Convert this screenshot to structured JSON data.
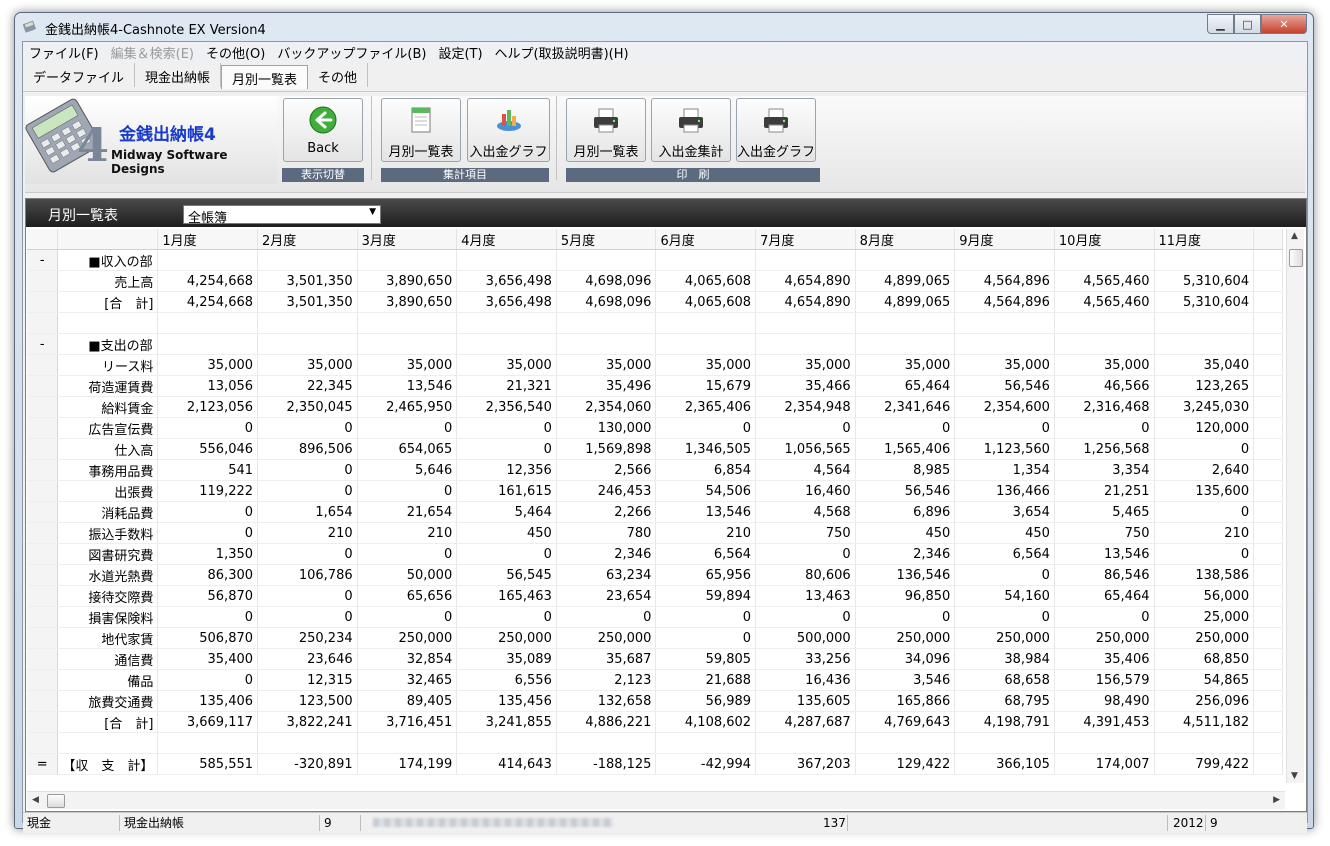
{
  "window": {
    "title": "金銭出納帳4-Cashnote EX Version4"
  },
  "menu": [
    {
      "label": "ファイル(F)",
      "disabled": false
    },
    {
      "label": "編集＆検索(E)",
      "disabled": true
    },
    {
      "label": "その他(O)",
      "disabled": false
    },
    {
      "label": "バックアップファイル(B)",
      "disabled": false
    },
    {
      "label": "設定(T)",
      "disabled": false
    },
    {
      "label": "ヘルプ(取扱説明書)(H)",
      "disabled": false
    }
  ],
  "tabs": [
    {
      "label": "データファイル",
      "active": false
    },
    {
      "label": "現金出納帳",
      "active": false
    },
    {
      "label": "月別一覧表",
      "active": true
    },
    {
      "label": "その他",
      "active": false
    }
  ],
  "logo": {
    "title": "金銭出納帳4",
    "subtitle": "Midway Software Designs",
    "digit": "4"
  },
  "toolbar": {
    "back_label": "Back",
    "group1_caption": "表示切替",
    "monthly_list_label": "月別一覧表",
    "inout_graph_label": "入出金グラフ",
    "group2_caption": "集計項目",
    "print_monthly_label": "月別一覧表",
    "print_summary_label": "入出金集計",
    "print_graph_label": "入出金グラフ",
    "group3_caption": "印　刷"
  },
  "panel": {
    "title": "月別一覧表",
    "ledger_selected": "全帳簿"
  },
  "table": {
    "columns": [
      "1月度",
      "2月度",
      "3月度",
      "4月度",
      "5月度",
      "6月度",
      "7月度",
      "8月度",
      "9月度",
      "10月度",
      "11月度"
    ],
    "rows": [
      {
        "mark": "-",
        "label": "■収入の部",
        "heading": true,
        "values": []
      },
      {
        "mark": "",
        "label": "売上高",
        "values": [
          "4,254,668",
          "3,501,350",
          "3,890,650",
          "3,656,498",
          "4,698,096",
          "4,065,608",
          "4,654,890",
          "4,899,065",
          "4,564,896",
          "4,565,460",
          "5,310,604"
        ]
      },
      {
        "mark": "",
        "label": "[合　計]",
        "values": [
          "4,254,668",
          "3,501,350",
          "3,890,650",
          "3,656,498",
          "4,698,096",
          "4,065,608",
          "4,654,890",
          "4,899,065",
          "4,564,896",
          "4,565,460",
          "5,310,604"
        ]
      },
      {
        "mark": "",
        "label": "",
        "values": []
      },
      {
        "mark": "-",
        "label": "■支出の部",
        "heading": true,
        "values": []
      },
      {
        "mark": "",
        "label": "リース料",
        "values": [
          "35,000",
          "35,000",
          "35,000",
          "35,000",
          "35,000",
          "35,000",
          "35,000",
          "35,000",
          "35,000",
          "35,000",
          "35,040"
        ]
      },
      {
        "mark": "",
        "label": "荷造運賃費",
        "values": [
          "13,056",
          "22,345",
          "13,546",
          "21,321",
          "35,496",
          "15,679",
          "35,466",
          "65,464",
          "56,546",
          "46,566",
          "123,265"
        ]
      },
      {
        "mark": "",
        "label": "給料賃金",
        "values": [
          "2,123,056",
          "2,350,045",
          "2,465,950",
          "2,356,540",
          "2,354,060",
          "2,365,406",
          "2,354,948",
          "2,341,646",
          "2,354,600",
          "2,316,468",
          "3,245,030"
        ]
      },
      {
        "mark": "",
        "label": "広告宣伝費",
        "values": [
          "0",
          "0",
          "0",
          "0",
          "130,000",
          "0",
          "0",
          "0",
          "0",
          "0",
          "120,000"
        ]
      },
      {
        "mark": "",
        "label": "仕入高",
        "values": [
          "556,046",
          "896,506",
          "654,065",
          "0",
          "1,569,898",
          "1,346,505",
          "1,056,565",
          "1,565,406",
          "1,123,560",
          "1,256,568",
          "0"
        ]
      },
      {
        "mark": "",
        "label": "事務用品費",
        "values": [
          "541",
          "0",
          "5,646",
          "12,356",
          "2,566",
          "6,854",
          "4,564",
          "8,985",
          "1,354",
          "3,354",
          "2,640"
        ]
      },
      {
        "mark": "",
        "label": "出張費",
        "values": [
          "119,222",
          "0",
          "0",
          "161,615",
          "246,453",
          "54,506",
          "16,460",
          "56,546",
          "136,466",
          "21,251",
          "135,600"
        ]
      },
      {
        "mark": "",
        "label": "消耗品費",
        "values": [
          "0",
          "1,654",
          "21,654",
          "5,464",
          "2,266",
          "13,546",
          "4,568",
          "6,896",
          "3,654",
          "5,465",
          "0"
        ]
      },
      {
        "mark": "",
        "label": "振込手数料",
        "values": [
          "0",
          "210",
          "210",
          "450",
          "780",
          "210",
          "750",
          "450",
          "450",
          "750",
          "210"
        ]
      },
      {
        "mark": "",
        "label": "図書研究費",
        "values": [
          "1,350",
          "0",
          "0",
          "0",
          "2,346",
          "6,564",
          "0",
          "2,346",
          "6,564",
          "13,546",
          "0"
        ]
      },
      {
        "mark": "",
        "label": "水道光熱費",
        "values": [
          "86,300",
          "106,786",
          "50,000",
          "56,545",
          "63,234",
          "65,956",
          "80,606",
          "136,546",
          "0",
          "86,546",
          "138,586"
        ]
      },
      {
        "mark": "",
        "label": "接待交際費",
        "values": [
          "56,870",
          "0",
          "65,656",
          "165,463",
          "23,654",
          "59,894",
          "13,463",
          "96,850",
          "54,160",
          "65,464",
          "56,000"
        ]
      },
      {
        "mark": "",
        "label": "損害保険料",
        "values": [
          "0",
          "0",
          "0",
          "0",
          "0",
          "0",
          "0",
          "0",
          "0",
          "0",
          "25,000"
        ]
      },
      {
        "mark": "",
        "label": "地代家賃",
        "values": [
          "506,870",
          "250,234",
          "250,000",
          "250,000",
          "250,000",
          "0",
          "500,000",
          "250,000",
          "250,000",
          "250,000",
          "250,000"
        ]
      },
      {
        "mark": "",
        "label": "通信費",
        "values": [
          "35,400",
          "23,646",
          "32,854",
          "35,089",
          "35,687",
          "59,805",
          "33,256",
          "34,096",
          "38,984",
          "35,406",
          "68,850"
        ]
      },
      {
        "mark": "",
        "label": "備品",
        "values": [
          "0",
          "12,315",
          "32,465",
          "6,556",
          "2,123",
          "21,688",
          "16,436",
          "3,546",
          "68,658",
          "156,579",
          "54,865"
        ]
      },
      {
        "mark": "",
        "label": "旅費交通費",
        "values": [
          "135,406",
          "123,500",
          "89,405",
          "135,456",
          "132,658",
          "56,989",
          "135,605",
          "165,866",
          "68,795",
          "98,490",
          "256,096"
        ]
      },
      {
        "mark": "",
        "label": "[合　計]",
        "values": [
          "3,669,117",
          "3,822,241",
          "3,716,451",
          "3,241,855",
          "4,886,221",
          "4,108,602",
          "4,287,687",
          "4,769,643",
          "4,198,791",
          "4,391,453",
          "4,511,182"
        ]
      },
      {
        "mark": "",
        "label": "",
        "values": []
      },
      {
        "mark": "=",
        "label": "【収　支　計】",
        "values": [
          "585,551",
          "-320,891",
          "174,199",
          "414,643",
          "-188,125",
          "-42,994",
          "367,203",
          "129,422",
          "366,105",
          "174,007",
          "799,422"
        ]
      }
    ]
  },
  "status": {
    "account": "現金",
    "book": "現金出納帳",
    "count": "9",
    "records": "137",
    "year": "2012",
    "month": "9"
  }
}
